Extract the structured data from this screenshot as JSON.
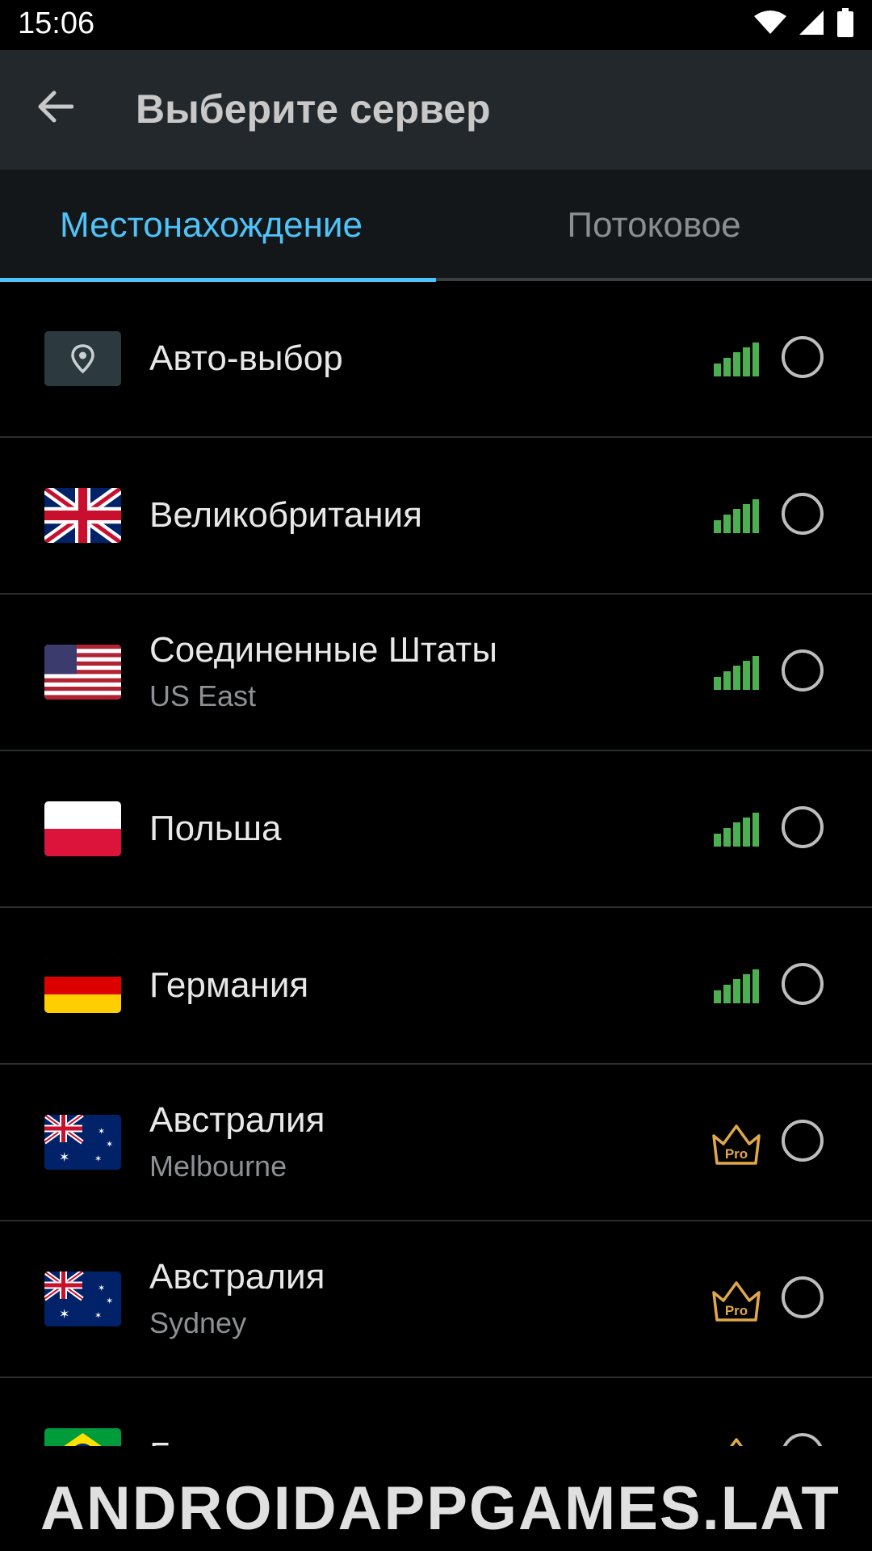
{
  "status_bar": {
    "time": "15:06"
  },
  "app_bar": {
    "title": "Выберите сервер"
  },
  "tabs": [
    {
      "label": "Местонахождение",
      "active": true
    },
    {
      "label": "Потоковое",
      "active": false
    }
  ],
  "servers": [
    {
      "title": "Авто-выбор",
      "subtitle": "",
      "flag": "location-pin",
      "status": "signal"
    },
    {
      "title": "Великобритания",
      "subtitle": "",
      "flag": "uk",
      "status": "signal"
    },
    {
      "title": "Соединенные Штаты",
      "subtitle": "US East",
      "flag": "us",
      "status": "signal"
    },
    {
      "title": "Польша",
      "subtitle": "",
      "flag": "poland",
      "status": "signal"
    },
    {
      "title": "Германия",
      "subtitle": "",
      "flag": "germany",
      "status": "signal"
    },
    {
      "title": "Австралия",
      "subtitle": "Melbourne",
      "flag": "australia",
      "status": "pro"
    },
    {
      "title": "Австралия",
      "subtitle": "Sydney",
      "flag": "australia",
      "status": "pro"
    },
    {
      "title": "Бразилия",
      "subtitle": "",
      "flag": "brazil",
      "status": "pro"
    }
  ],
  "pro_badge": "Pro",
  "watermark": "ANDROIDAPPGAMES.LAT",
  "colors": {
    "accent": "#4fc3f7",
    "signal": "#4caf50",
    "pro": "#e0a84a",
    "app_bar": "#22282c"
  }
}
